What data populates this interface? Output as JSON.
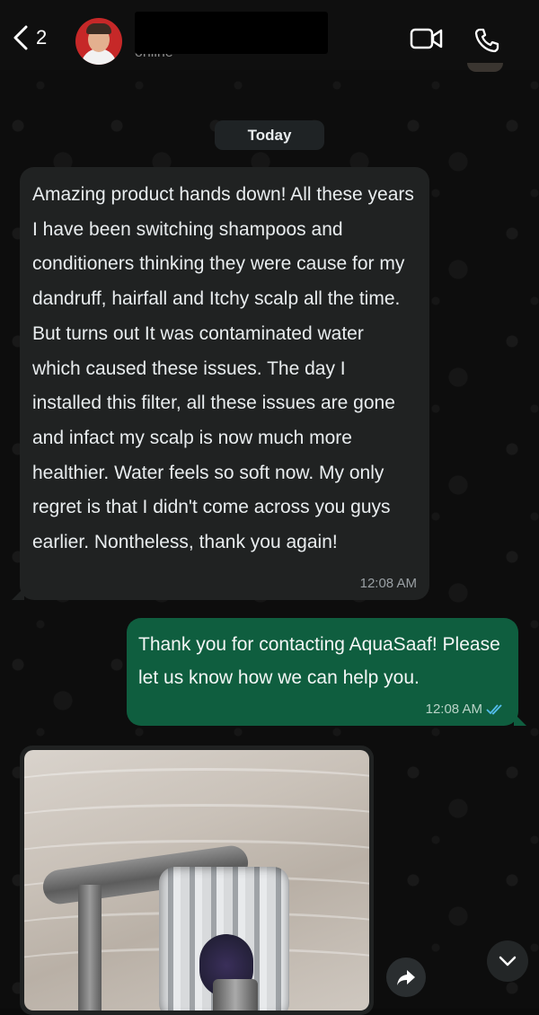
{
  "header": {
    "back_count": "2",
    "status": "online",
    "icons": {
      "back": "chevron-left-icon",
      "video": "video-call-icon",
      "phone": "phone-call-icon"
    }
  },
  "chat": {
    "date_label": "Today",
    "messages": [
      {
        "direction": "incoming",
        "text": "Amazing product hands down! All these years I have been switching shampoos and conditioners thinking they were cause for my dandruff, hairfall and Itchy scalp all the time. But turns out It was contaminated water which caused these issues. The day I installed this filter, all these issues are gone and infact my scalp is now much more healthier. Water feels so soft now. My only regret is that I didn't come across you guys earlier. Nontheless, thank you again!",
        "time": "12:08 AM"
      },
      {
        "direction": "outgoing",
        "text": "Thank you for contacting AquaSaaf! Please let us know how we can help you.",
        "time": "12:08 AM",
        "status": "read"
      },
      {
        "direction": "incoming",
        "type": "image",
        "subject": "shower filter attached to shower arm"
      }
    ]
  },
  "colors": {
    "incoming_bubble": "#202222",
    "outgoing_bubble": "#0f5e3f",
    "read_ticks": "#53bdeb",
    "background": "#0b0b0b"
  },
  "floating": {
    "forward_icon": "forward-share-icon",
    "scroll_icon": "chevron-down-icon"
  }
}
